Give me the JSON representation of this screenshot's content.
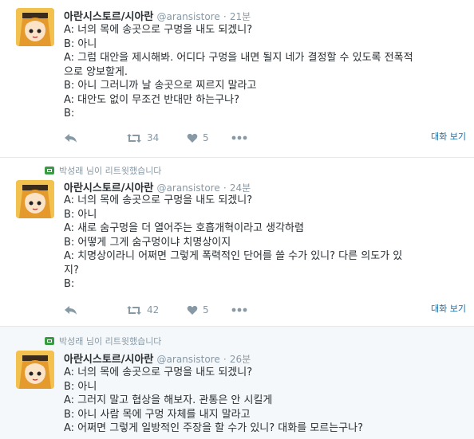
{
  "tweets": [
    {
      "retweeted_by": "",
      "name": "아란시스토르/시아란",
      "handle": "@aransistore",
      "dot": "·",
      "time": "21분",
      "lines": [
        "A: 너의 목에 송곳으로 구멍을 내도 되겠니?",
        "B: 아니",
        "A: 그럼 대안을 제시해봐. 어디다 구멍을 내면 될지 네가 결정할 수 있도록 전폭적",
        "으로 양보할게.",
        "B: 아니 그러니까 날 송곳으로 찌르지 말라고",
        "A: 대안도 없이 무조건 반대만 하는구나?",
        "B:"
      ],
      "retweets": "34",
      "likes": "5",
      "conversation": "대화 보기"
    },
    {
      "retweeted_by": "박성래 님이 리트윗했습니다",
      "name": "아란시스토르/시아란",
      "handle": "@aransistore",
      "dot": "·",
      "time": "24분",
      "lines": [
        "A: 너의 목에 송곳으로 구멍을 내도 되겠니?",
        "B: 아니",
        "A: 새로 숨구멍을 더 열어주는 호흡개혁이라고 생각하렴",
        "B: 어떻게 그게 숨구멍이냐 치명상이지",
        "A: 치명상이라니 어쩌면 그렇게 폭력적인 단어를 쓸 수가 있니? 다른 의도가 있",
        "지?",
        "B:"
      ],
      "retweets": "42",
      "likes": "5",
      "conversation": "대화 보기"
    },
    {
      "retweeted_by": "박성래 님이 리트윗했습니다",
      "name": "아란시스토르/시아란",
      "handle": "@aransistore",
      "dot": "·",
      "time": "26분",
      "lines": [
        "A: 너의 목에 송곳으로 구멍을 내도 되겠니?",
        "B: 아니",
        "A: 그러지 말고 협상을 해보자. 관통은 안 시킬게",
        "B: 아니 사람 목에 구멍 자체를 내지 말라고",
        "A: 어쩌면 그렇게 일방적인 주장을 할 수가 있니? 대화를 모르는구나?"
      ],
      "retweets": "",
      "likes": "",
      "conversation": ""
    }
  ],
  "icons": {
    "reply": "reply-icon",
    "retweet": "retweet-icon",
    "like": "heart-icon",
    "more": "more-icon",
    "retweeted": "retweeted-icon"
  },
  "colors": {
    "text": "#292f33",
    "muted": "#8899a6",
    "link": "#1b6ea8",
    "retweet_badge": "#3a9b45",
    "highlight_bg": "#f5f8fa"
  }
}
